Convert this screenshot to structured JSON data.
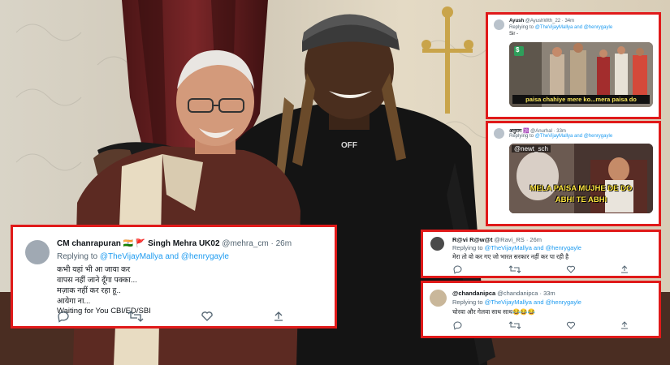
{
  "left_tweet": {
    "name": "CM chanrapuran",
    "flag1": "🇮🇳",
    "flag2": "🚩",
    "name2": "Singh Mehra UK02",
    "handle": "@mehra_cm",
    "time": "· 26m",
    "replying_prefix": "Replying to",
    "replying_to": "@TheVijayMallya and @henrygayle",
    "lines": [
      "कभी यहां भी आ जाया कर",
      "वापस नहीं जाने दूँगा पक्का...",
      "मज़ाक नहीं कर रहा हू..",
      "आयेगा ना...",
      "Waiting for You CBI/ED/SBI"
    ]
  },
  "shirt_text": "OFF",
  "tr1": {
    "name": "Ayush",
    "handle": "@AyushWth_22 · 34m",
    "replying_prefix": "Replying to",
    "replying_to": "@TheVijayMallya and @henrygayle",
    "text": "Sir -",
    "meme_caption": "paisa chahiye mere ko...mera paisa do",
    "meme_logo": "$"
  },
  "tr2": {
    "name": "अनुराग 🕉️",
    "handle": "@Anurhal · 33m",
    "replying_prefix": "Replying to",
    "replying_to": "@TheVijayMallya and @henrygayle",
    "meme_tag": "@newt_sch",
    "meme_caption_1": "MELA PAISA MUJHE DE DO",
    "meme_caption_2": "ABHI TE ABHI"
  },
  "tr3": {
    "name": "R@vi R@w@t",
    "handle": "@Ravi_RS · 26m",
    "replying_prefix": "Replying to",
    "replying_to": "@TheVijayMallya and @henrygayle",
    "text": "मेरा तो वो कर गए जो भारत सरकार नहीं कर पा रही है"
  },
  "tr4": {
    "name": "@chandanipca",
    "handle": "@chandanipca · 33m",
    "replying_prefix": "Replying to",
    "replying_to": "@TheVijayMallya and @henrygayle",
    "text": "चोरवा और गेलवा साथ साथ😂😂😂"
  },
  "colors": {
    "highlight_border": "#e01a1a",
    "link": "#1d9bf0",
    "muted": "#536471"
  }
}
